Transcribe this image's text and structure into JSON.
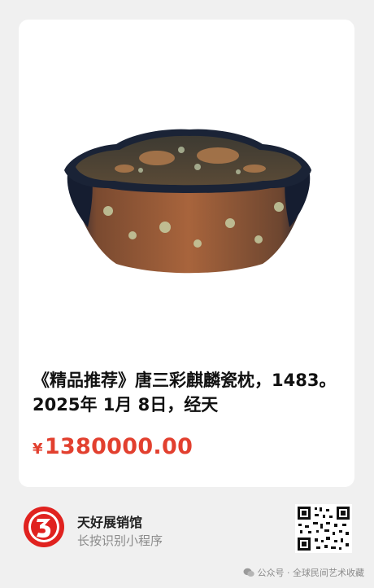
{
  "card": {
    "title": "《精品推荐》唐三彩麒麟瓷枕，1483。2025年 1月 8日，经天",
    "currency": "¥",
    "price": "1380000.00"
  },
  "miniprogram": {
    "name": "天好展销馆",
    "hint": "长按识别小程序",
    "logo_icon": "red-circle-3-logo"
  },
  "watermark": {
    "text": "公众号 · 全球民间艺术收藏",
    "icon": "wechat-icon"
  },
  "colors": {
    "price": "#e2402f",
    "logo_red": "#e0221f",
    "background": "#f0f0f0"
  }
}
